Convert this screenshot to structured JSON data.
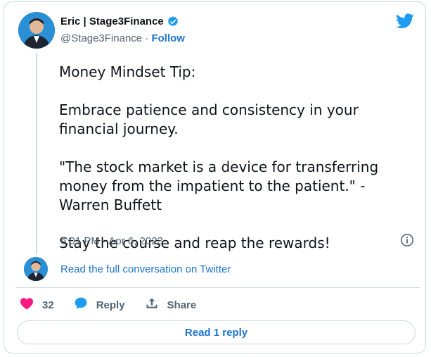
{
  "author": {
    "name": "Eric | Stage3Finance",
    "handle": "@Stage3Finance",
    "separator": " · ",
    "follow_label": "Follow"
  },
  "tweet": {
    "lines": [
      "Money Mindset Tip:",
      "Embrace patience and consistency in your financial journey.",
      "\"The stock market is a device for transferring money from the impatient to the patient.\" - Warren Buffett",
      "Stay the course and reap the rewards!"
    ],
    "timestamp": "6:01 PM · Apr 6, 2023"
  },
  "conversation_link": "Read the full conversation on Twitter",
  "actions": {
    "like_count": "32",
    "reply_label": "Reply",
    "share_label": "Share"
  },
  "read_reply_label": "Read 1 reply",
  "icons": {
    "verified": "verified-badge-icon",
    "twitter": "twitter-bird-icon",
    "info": "info-icon",
    "like": "heart-icon",
    "reply": "speech-bubble-icon",
    "share": "share-upload-icon"
  },
  "colors": {
    "brand_blue": "#1d9bf0",
    "link_blue": "#1d74cf",
    "like_red": "#f91880",
    "text_primary": "#0f1419",
    "text_secondary": "#536471",
    "border": "#cfd9de"
  }
}
